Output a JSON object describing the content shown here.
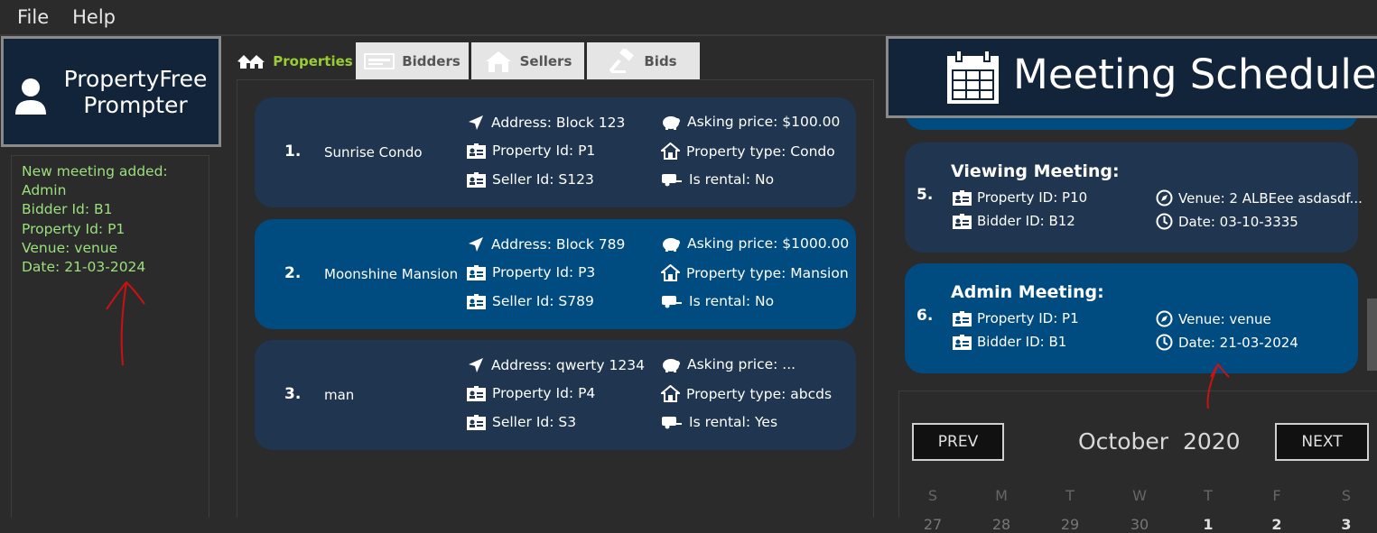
{
  "menu": {
    "file": "File",
    "help": "Help"
  },
  "logo": {
    "title": "PropertyFree Prompter"
  },
  "result_lines": [
    "New meeting added:",
    "Admin",
    "Bidder Id: B1",
    "Property Id: P1",
    "Venue: venue",
    "Date: 21-03-2024"
  ],
  "tabs": [
    "Properties",
    "Bidders",
    "Sellers",
    "Bids"
  ],
  "properties": [
    {
      "index": "1.",
      "name": "Sunrise Condo",
      "address": "Address: Block 123",
      "property_id": "Property Id: P1",
      "seller_id": "Seller Id: S123",
      "price": "Asking price: $100.00",
      "type": "Property type: Condo",
      "rental": "Is rental: No"
    },
    {
      "index": "2.",
      "name": "Moonshine Mansion",
      "address": "Address: Block 789",
      "property_id": "Property Id: P3",
      "seller_id": "Seller Id: S789",
      "price": "Asking price: $1000.00",
      "type": "Property type: Mansion",
      "rental": "Is rental: No"
    },
    {
      "index": "3.",
      "name": "man",
      "address": "Address: qwerty 1234",
      "property_id": "Property Id: P4",
      "seller_id": "Seller Id: S3",
      "price": "Asking price: ...",
      "type": "Property type: abcds",
      "rental": "Is rental: Yes"
    }
  ],
  "schedule": {
    "title": "Meeting Schedule",
    "meetings": [
      {
        "index": "5.",
        "title": "Viewing Meeting:",
        "property_id": "Property ID: P10",
        "bidder_id": "Bidder ID: B12",
        "venue": "Venue: 2 ALBEee asdasdf...",
        "date": "Date: 03-10-3335"
      },
      {
        "index": "6.",
        "title": "Admin Meeting:",
        "property_id": "Property ID: P1",
        "bidder_id": "Bidder ID: B1",
        "venue": "Venue: venue",
        "date": "Date: 21-03-2024"
      }
    ]
  },
  "calendar": {
    "prev": "PREV",
    "next": "NEXT",
    "month": "October",
    "year": "2020",
    "weekdays": [
      "S",
      "M",
      "T",
      "W",
      "T",
      "F",
      "S"
    ],
    "dates": [
      "27",
      "28",
      "29",
      "30",
      "1",
      "2",
      "3"
    ]
  },
  "colors": {
    "card": "#1f3550",
    "card_selected": "#004b80",
    "result_text": "#9be07c",
    "active_tab": "#9acd32",
    "annotation": "#cc1111"
  }
}
